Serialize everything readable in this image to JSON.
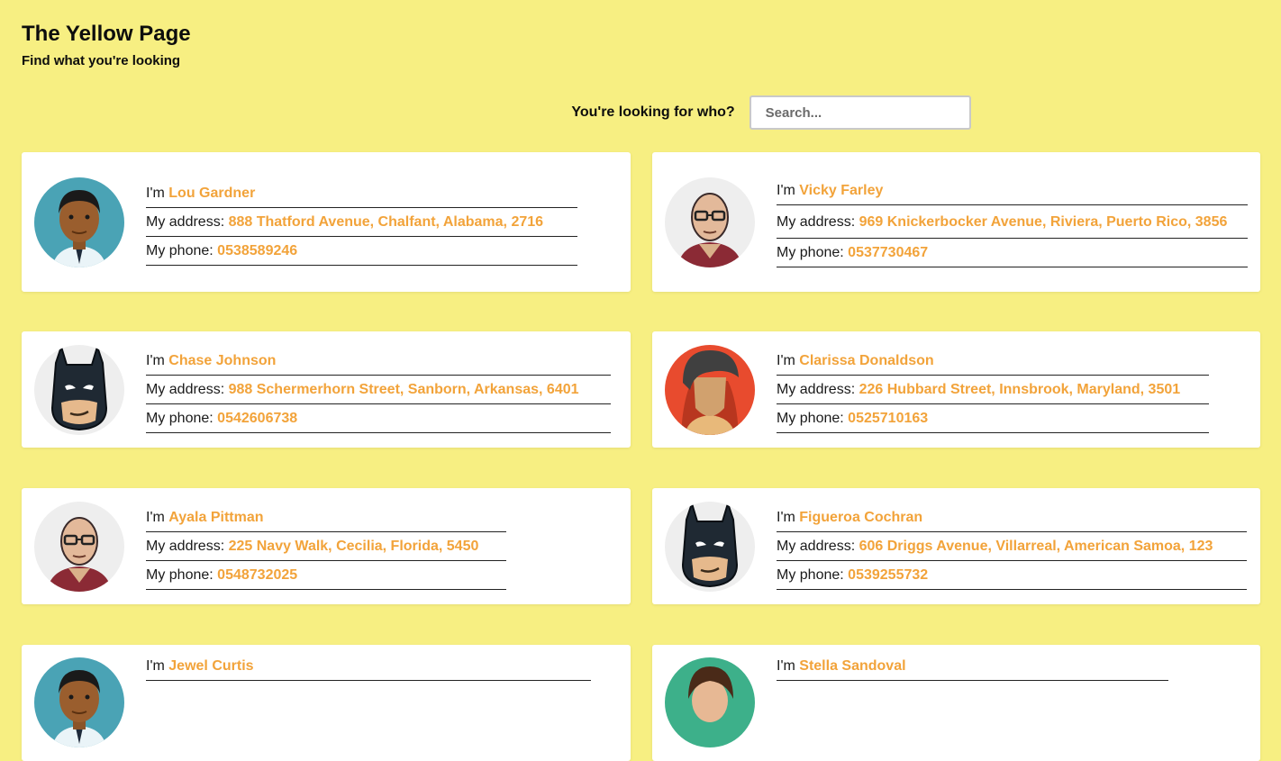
{
  "header": {
    "title": "The Yellow Page",
    "subtitle": "Find what you're looking"
  },
  "search": {
    "label": "You're looking for who?",
    "placeholder": "Search..."
  },
  "labels": {
    "name_prefix": "I'm",
    "address_prefix": "My address:",
    "phone_prefix": "My phone:"
  },
  "people": [
    {
      "name": "Lou Gardner",
      "address": "888 Thatford Avenue, Chalfant, Alabama, 2716",
      "phone": "0538589246",
      "avatar": "man-dark-skin-icon"
    },
    {
      "name": "Vicky Farley",
      "address": "969 Knickerbocker Avenue, Riviera, Puerto Rico, 3856",
      "phone": "0537730467",
      "avatar": "bald-man-glasses-icon"
    },
    {
      "name": "Chase Johnson",
      "address": "988 Schermerhorn Street, Sanborn, Arkansas, 6401",
      "phone": "0542606738",
      "avatar": "batman-icon"
    },
    {
      "name": "Clarissa Donaldson",
      "address": "226 Hubbard Street, Innsbrook, Maryland, 3501",
      "phone": "0525710163",
      "avatar": "woman-red-icon"
    },
    {
      "name": "Ayala Pittman",
      "address": "225 Navy Walk, Cecilia, Florida, 5450",
      "phone": "0548732025",
      "avatar": "bald-man-glasses-icon"
    },
    {
      "name": "Figueroa Cochran",
      "address": "606 Driggs Avenue, Villarreal, American Samoa, 123",
      "phone": "0539255732",
      "avatar": "batman-icon"
    },
    {
      "name": "Jewel Curtis",
      "avatar": "man-dark-skin-icon"
    },
    {
      "name": "Stella Sandoval",
      "avatar": "woman-teal-icon"
    }
  ],
  "colors": {
    "background": "#f7ef82",
    "accent": "#f2a33a"
  }
}
